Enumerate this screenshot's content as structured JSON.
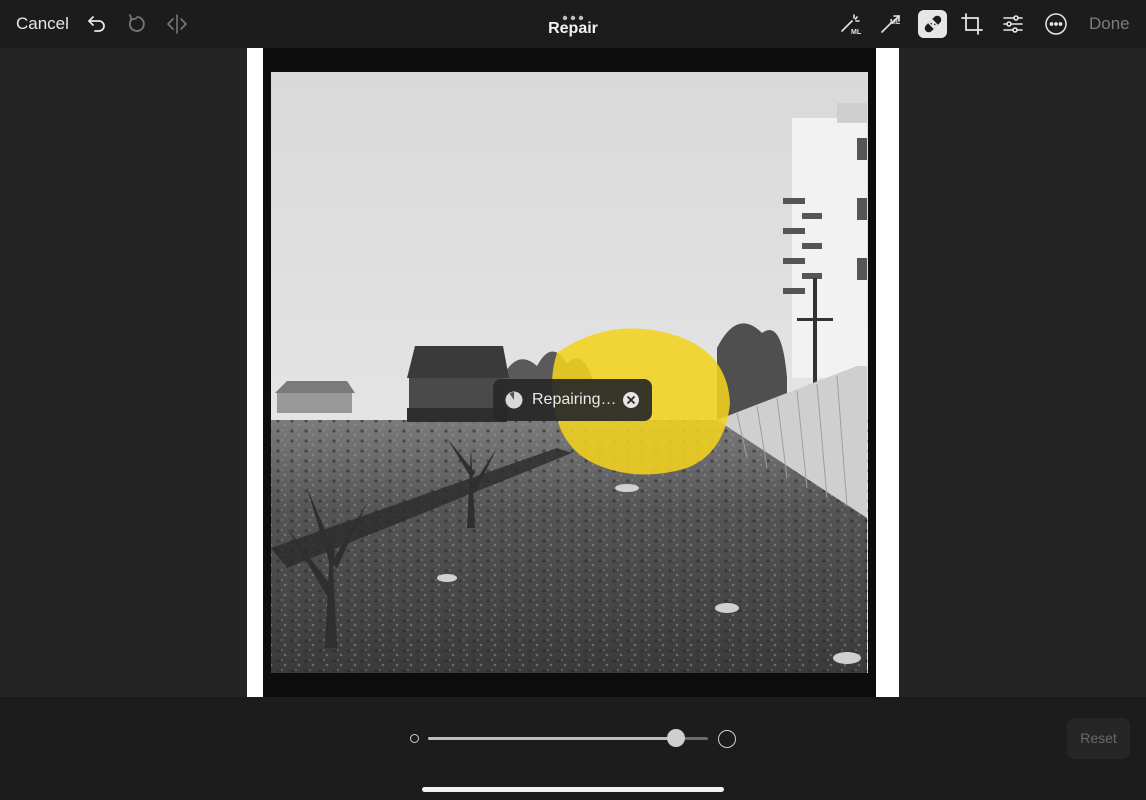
{
  "toolbar": {
    "cancel_label": "Cancel",
    "title": "Repair",
    "done_label": "Done",
    "icons": [
      "undo-icon",
      "redo-icon",
      "compare-icon",
      "ml-magic-wand-icon",
      "ml-denoise-icon",
      "repair-bandage-icon",
      "crop-icon",
      "adjust-sliders-icon",
      "more-icon"
    ],
    "active_tool": "repair-bandage-icon"
  },
  "toast": {
    "label": "Repairing…"
  },
  "brush_size": {
    "value": 0.885
  },
  "footer": {
    "reset_label": "Reset"
  },
  "colors": {
    "accent_selection": "#f2d21e",
    "toolbar_bg": "#1c1c1c",
    "canvas_bg": "#242424"
  }
}
